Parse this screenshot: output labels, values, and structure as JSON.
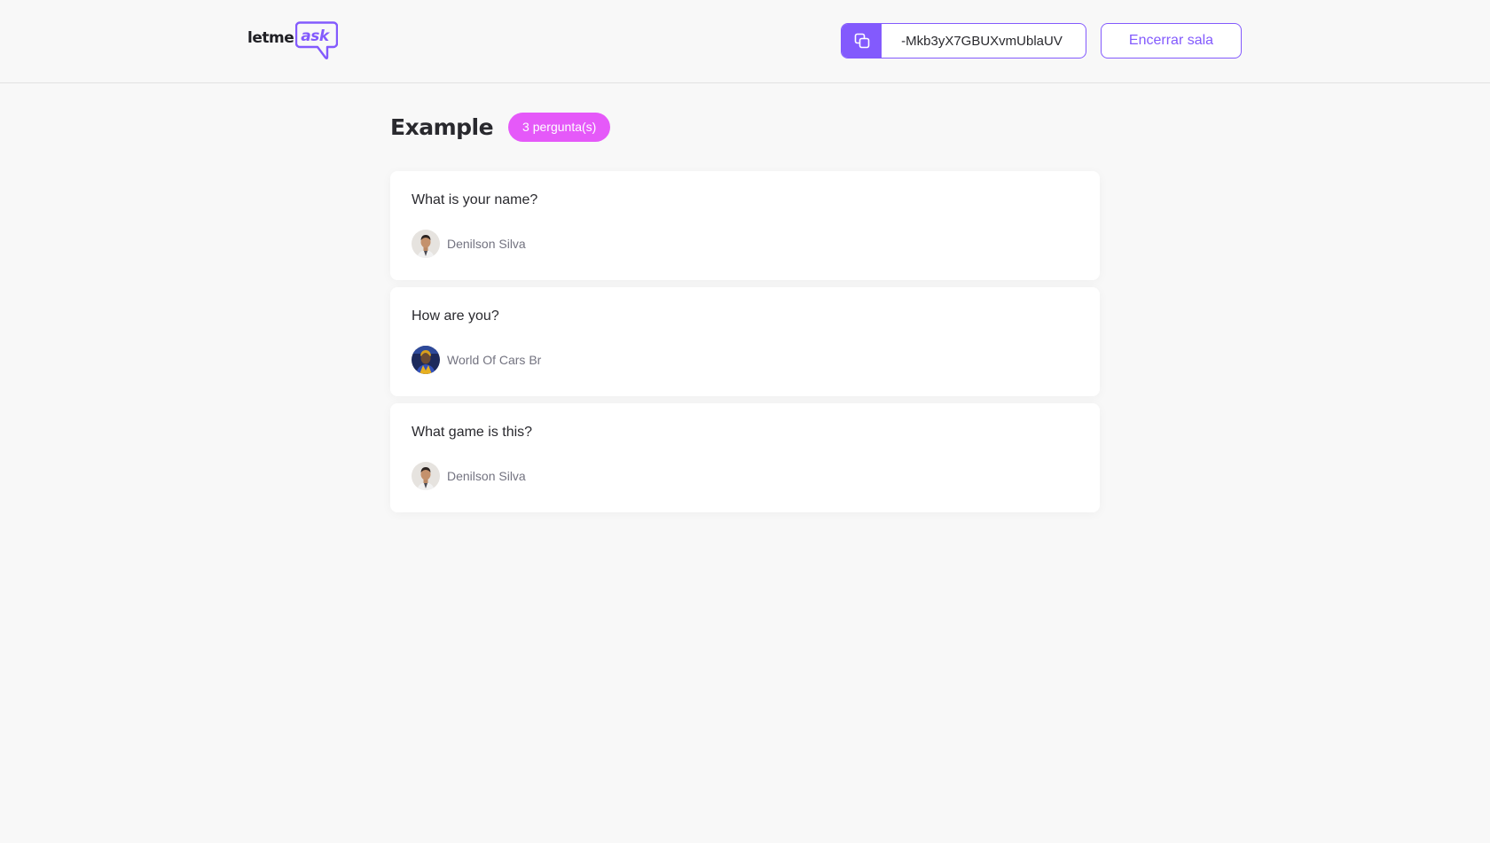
{
  "header": {
    "logo_main": "letme",
    "logo_accent": "ask",
    "room_code": "-Mkb3yX7GBUXvmUblaUV",
    "close_room_label": "Encerrar sala"
  },
  "room": {
    "title": "Example",
    "question_count_label": "3 pergunta(s)"
  },
  "questions": [
    {
      "content": "What is your name?",
      "author": "Denilson Silva"
    },
    {
      "content": "How are you?",
      "author": "World Of Cars Br"
    },
    {
      "content": "What game is this?",
      "author": "Denilson Silva"
    }
  ],
  "colors": {
    "accent": "#835afd",
    "badge": "#e559f9",
    "background": "#f8f8f8",
    "text": "#29292e",
    "muted": "#737380"
  },
  "icons": {
    "copy": "copy-icon",
    "logo": "speech-bubble-logo"
  }
}
